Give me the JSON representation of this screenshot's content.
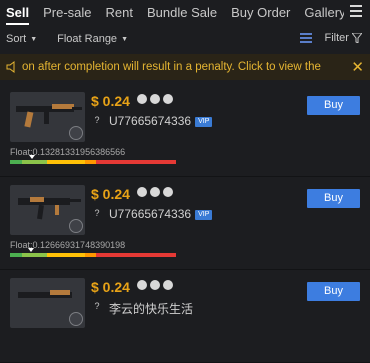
{
  "tabs": [
    {
      "label": "Sell",
      "active": true
    },
    {
      "label": "Pre-sale",
      "active": false
    },
    {
      "label": "Rent",
      "active": false
    },
    {
      "label": "Bundle Sale",
      "active": false
    },
    {
      "label": "Buy Order",
      "active": false
    },
    {
      "label": "Gallery",
      "active": false
    }
  ],
  "filters": {
    "sort_label": "Sort",
    "float_range_label": "Float Range",
    "filter_label": "Filter"
  },
  "notice": {
    "text": "on after completion will result in a penalty. Click to view the"
  },
  "items": [
    {
      "price": "$ 0.24",
      "seller": "U77665674336",
      "float_label": "Float:0.13281331956386566",
      "float_value": 0.13281331956386566
    },
    {
      "price": "$ 0.24",
      "seller": "U77665674336",
      "float_label": "Float:0.12666931748390198",
      "float_value": 0.12666931748390198
    },
    {
      "price": "$ 0.24",
      "seller": "李云的快乐生活",
      "float_label": "",
      "float_value": null
    }
  ],
  "buy_label": "Buy",
  "seller_tag": "VIP",
  "colors": {
    "price": "#e8a317",
    "buy_button": "#3d7de0",
    "notice_text": "#e5b532",
    "float_segments": [
      "#4caf50",
      "#8bc34a",
      "#ffc107",
      "#ff9800",
      "#e53935"
    ]
  }
}
